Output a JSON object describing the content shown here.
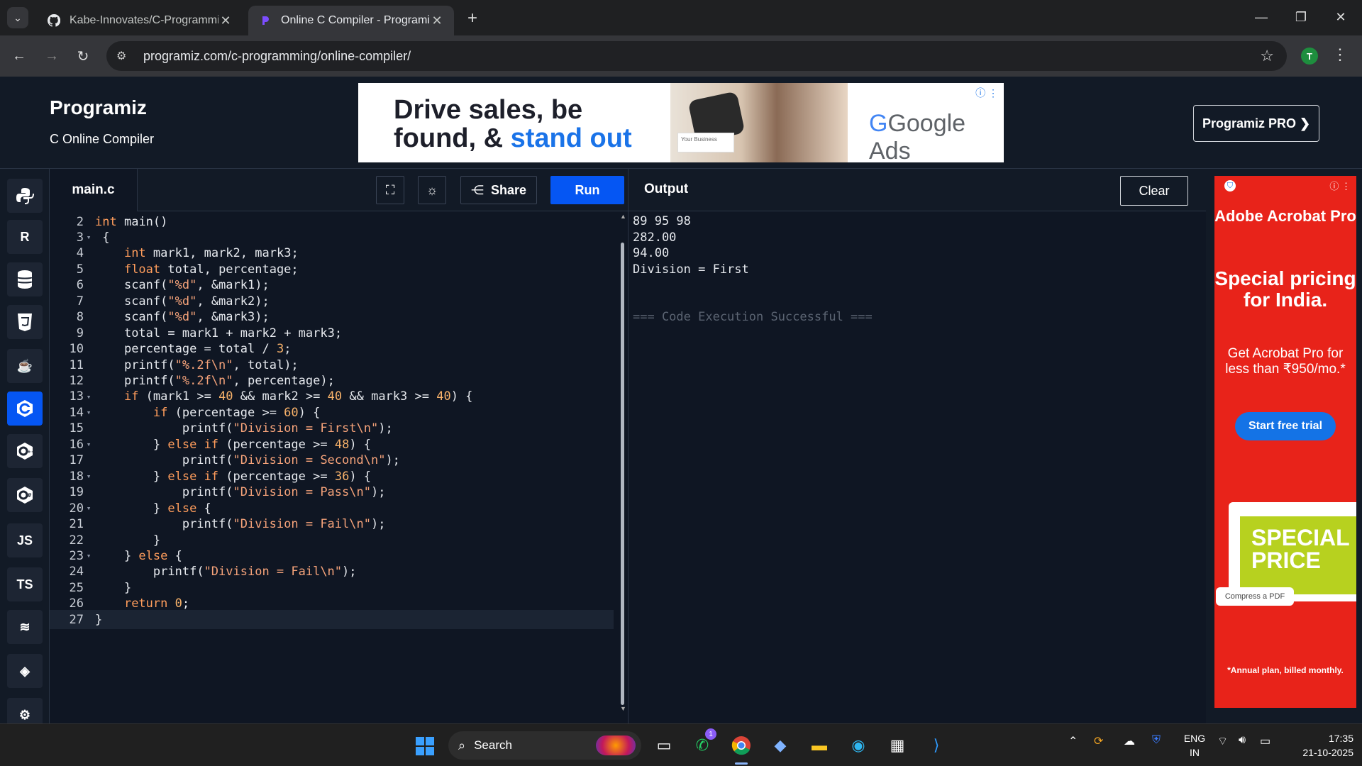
{
  "browser": {
    "tabs": [
      {
        "title": "Kabe-Innovates/C-Programmin",
        "favicon": "github-icon",
        "active": false
      },
      {
        "title": "Online C Compiler - Programiz",
        "favicon": "programiz-icon",
        "active": true
      }
    ],
    "url": "programiz.com/c-programming/online-compiler/",
    "profile_initial": "T"
  },
  "site": {
    "logo": "Programiz",
    "subtitle": "C Online Compiler",
    "pro_button": "Programiz PRO ❯",
    "ad": {
      "headline_1": "Drive sales, be",
      "headline_2a": "found, & ",
      "headline_2b": "stand out",
      "brand": "Google Ads",
      "card_text": "Your Business"
    }
  },
  "languages": [
    {
      "name": "Python",
      "icon": "python-icon"
    },
    {
      "name": "R",
      "icon": "r-icon"
    },
    {
      "name": "SQL",
      "icon": "database-icon"
    },
    {
      "name": "HTML",
      "icon": "html5-icon"
    },
    {
      "name": "Java",
      "icon": "java-icon"
    },
    {
      "name": "C",
      "icon": "c-icon",
      "active": true
    },
    {
      "name": "C++",
      "icon": "cpp-icon"
    },
    {
      "name": "C#",
      "icon": "csharp-icon"
    },
    {
      "name": "JS",
      "icon": "js-icon",
      "label": "JS"
    },
    {
      "name": "TS",
      "icon": "ts-icon",
      "label": "TS"
    },
    {
      "name": "Swift",
      "icon": "swift-icon"
    },
    {
      "name": "Go",
      "icon": "go-icon"
    },
    {
      "name": "Rust",
      "icon": "rust-icon"
    }
  ],
  "editor": {
    "filename": "main.c",
    "share_label": "Share",
    "run_label": "Run",
    "lines": [
      {
        "n": "2",
        "fold": false,
        "code": "int main()"
      },
      {
        "n": "3",
        "fold": true,
        "code": " {"
      },
      {
        "n": "4",
        "fold": false,
        "code": "    int mark1, mark2, mark3;"
      },
      {
        "n": "5",
        "fold": false,
        "code": "    float total, percentage;"
      },
      {
        "n": "6",
        "fold": false,
        "code": "    scanf(\"%d\", &mark1);"
      },
      {
        "n": "7",
        "fold": false,
        "code": "    scanf(\"%d\", &mark2);"
      },
      {
        "n": "8",
        "fold": false,
        "code": "    scanf(\"%d\", &mark3);"
      },
      {
        "n": "9",
        "fold": false,
        "code": "    total = mark1 + mark2 + mark3;"
      },
      {
        "n": "10",
        "fold": false,
        "code": "    percentage = total / 3;"
      },
      {
        "n": "11",
        "fold": false,
        "code": "    printf(\"%.2f\\n\", total);"
      },
      {
        "n": "12",
        "fold": false,
        "code": "    printf(\"%.2f\\n\", percentage);"
      },
      {
        "n": "13",
        "fold": true,
        "code": "    if (mark1 >= 40 && mark2 >= 40 && mark3 >= 40) {"
      },
      {
        "n": "14",
        "fold": true,
        "code": "        if (percentage >= 60) {"
      },
      {
        "n": "15",
        "fold": false,
        "code": "            printf(\"Division = First\\n\");"
      },
      {
        "n": "16",
        "fold": true,
        "code": "        } else if (percentage >= 48) {"
      },
      {
        "n": "17",
        "fold": false,
        "code": "            printf(\"Division = Second\\n\");"
      },
      {
        "n": "18",
        "fold": true,
        "code": "        } else if (percentage >= 36) {"
      },
      {
        "n": "19",
        "fold": false,
        "code": "            printf(\"Division = Pass\\n\");"
      },
      {
        "n": "20",
        "fold": true,
        "code": "        } else {"
      },
      {
        "n": "21",
        "fold": false,
        "code": "            printf(\"Division = Fail\\n\");"
      },
      {
        "n": "22",
        "fold": false,
        "code": "        }"
      },
      {
        "n": "23",
        "fold": true,
        "code": "    } else {"
      },
      {
        "n": "24",
        "fold": false,
        "code": "        printf(\"Division = Fail\\n\");"
      },
      {
        "n": "25",
        "fold": false,
        "code": "    }"
      },
      {
        "n": "26",
        "fold": false,
        "code": "    return 0;"
      },
      {
        "n": "27",
        "fold": false,
        "code": "}",
        "current": true
      }
    ]
  },
  "output": {
    "title": "Output",
    "clear_label": "Clear",
    "lines": [
      "89 95 98",
      "282.00",
      "94.00",
      "Division = First",
      "",
      "",
      "=== Code Execution Successful ==="
    ]
  },
  "side_ad": {
    "brand": "Adobe Acrobat Pro",
    "headline": "Special pricing for India.",
    "body": "Get Acrobat Pro for less than ₹950/mo.*",
    "cta": "Start free trial",
    "promo": "SPECIAL PRICE",
    "chip": "Compress a PDF",
    "footer": "*Annual plan, billed monthly."
  },
  "taskbar": {
    "search": "Search",
    "whatsapp_badge": "1",
    "lang_1": "ENG",
    "lang_2": "IN",
    "time": "17:35",
    "date": "21-10-2025"
  },
  "colors": {
    "accent": "#0556f3",
    "editor_bg": "#0f1623",
    "keyword": "#ff9d5c",
    "string": "#f6a37a",
    "ad_red": "#e8231a"
  }
}
